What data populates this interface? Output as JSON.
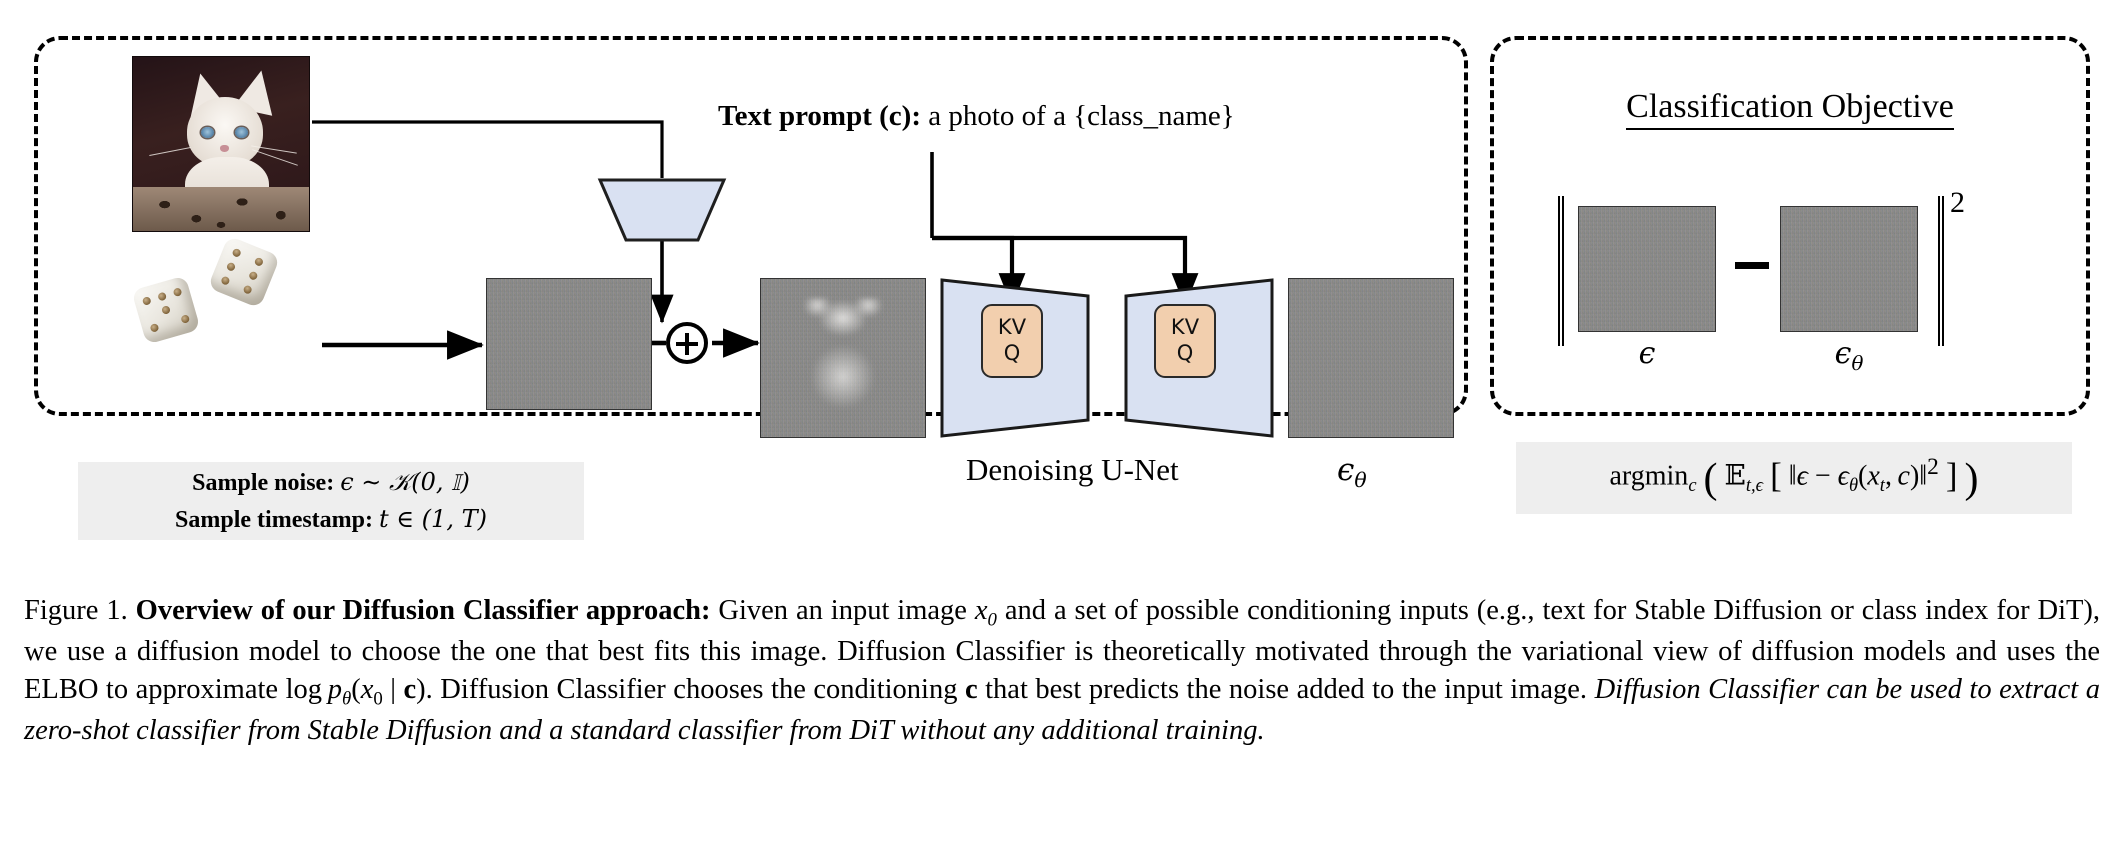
{
  "figure": {
    "left_panel": {
      "input_image_label": "Input Image",
      "text_prompt_bold": "Text prompt (c):",
      "text_prompt_value": "a photo of a {class_name}",
      "epsilon_label": "ϵ",
      "epsilon_theta_label": "ϵθ",
      "unet_label": "Denoising U-Net",
      "attention_block": {
        "kv": "KV",
        "q": "Q"
      },
      "sample_box": {
        "noise_label": "Sample noise:",
        "noise_value": "ϵ ~ 𝒩(0, 𝕀)",
        "timestamp_label": "Sample timestamp:",
        "timestamp_value": "t ∈ (1, T)"
      },
      "icons": {
        "cat_photo": "cat-photo-icon",
        "dice": "dice-icon",
        "plus_operator": "circled-plus-icon",
        "text_encoder": "encoder-trapezoid-icon"
      }
    },
    "right_panel": {
      "title": "Classification Objective",
      "norm_exponent": "2",
      "minus_operator": "−",
      "epsilon_caption": "ϵ",
      "epsilon_theta_caption": "ϵθ",
      "argmin_formula": "argmin_c ( 𝔼_{t,ϵ} [ ‖ϵ − ϵθ(x_t, c)‖² ] )"
    },
    "caption": {
      "figure_number": "Figure 1.",
      "title_bold": "Overview of our Diffusion Classifier approach:",
      "body_1": "Given an input image ",
      "x0": "x0",
      "body_2": " and a set of possible conditioning inputs (e.g., text for Stable Diffusion or class index for DiT), we use a diffusion model to choose the one that best fits this image. Diffusion Classifier is theoretically motivated through the variational view of diffusion models and uses the ELBO to approximate ",
      "log_term": "log pθ(x0 | c)",
      "body_3": ". Diffusion Classifier chooses the conditioning ",
      "c_bold": "c",
      "body_4": " that best predicts the noise added to the input image. ",
      "italic_tail": "Diffusion Classifier can be used to extract a zero-shot classifier from Stable Diffusion and a standard classifier from DiT without any additional training."
    },
    "colors": {
      "unet_fill": "#d9e1f2",
      "attention_fill": "#f2cfae",
      "panel_border": "#000000",
      "gray_box": "#eeeeee",
      "background": "#ffffff"
    }
  }
}
